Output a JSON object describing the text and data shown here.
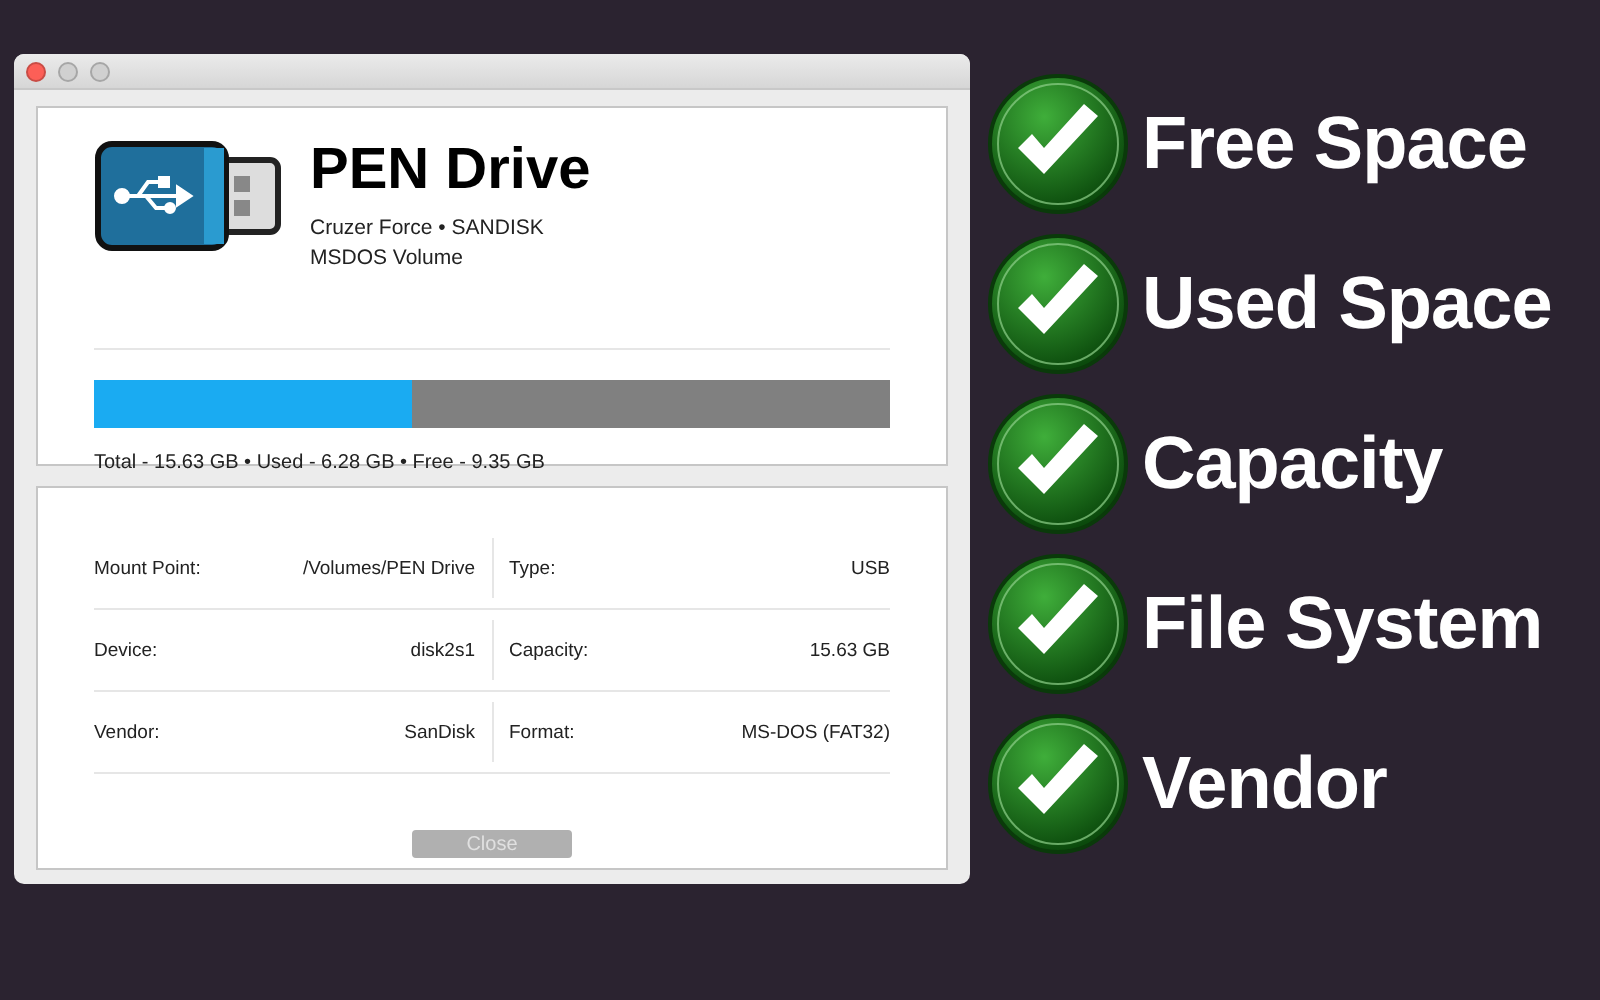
{
  "window": {
    "title_buttons": [
      {
        "kind": "close"
      },
      {
        "kind": "minimize"
      },
      {
        "kind": "zoom"
      }
    ]
  },
  "drive": {
    "name": "PEN Drive",
    "model": "Cruzer Force • SANDISK",
    "volume": "MSDOS Volume",
    "usage": {
      "level": 0.4
    },
    "summary": "Total - 15.63 GB • Used - 6.28 GB • Free - 9.35 GB"
  },
  "info": [
    [
      {
        "label": "Mount Point:",
        "value": "/Volumes/PEN Drive"
      },
      {
        "label": "Type:",
        "value": "USB"
      }
    ],
    [
      {
        "label": "Device:",
        "value": "disk2s1"
      },
      {
        "label": "Capacity:",
        "value": "15.63 GB"
      }
    ],
    [
      {
        "label": "Vendor:",
        "value": "SanDisk"
      },
      {
        "label": "Format:",
        "value": "MS-DOS (FAT32)"
      }
    ]
  ],
  "close_button": {
    "label": "Close",
    "disabled": true
  },
  "features": [
    "Free Space",
    "Used Space",
    "Capacity",
    "File System",
    "Vendor"
  ]
}
